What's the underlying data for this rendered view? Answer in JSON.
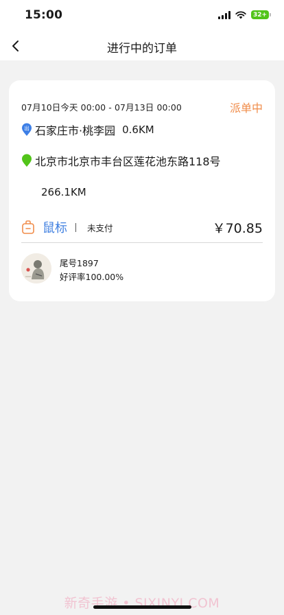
{
  "status_bar": {
    "time": "15:00",
    "battery": "32+",
    "icons": [
      "signal-icon",
      "wifi-icon",
      "battery-icon"
    ]
  },
  "nav": {
    "title": "进行中的订单",
    "back_icon": "chevron-left-icon"
  },
  "order": {
    "time_range": "07月10日今天 00:00 - 07月13日 00:00",
    "status": "派单中",
    "pickup": {
      "icon": "pickup-marker-icon",
      "marker_char": "出",
      "address": "石家庄市·桃李园",
      "distance": "0.6KM"
    },
    "destination": {
      "icon": "location-pin-icon",
      "address": "北京市北京市丰台区莲花池东路118号"
    },
    "total_distance": "266.1KM",
    "goods": {
      "icon": "bag-icon",
      "name": "鼠标",
      "payment_status": "未支付"
    },
    "price": "￥70.85",
    "driver": {
      "plate_tail": "尾号1897",
      "rating": "好评率100.00%"
    }
  },
  "watermark": "新奇手游 • SIXINYI.COM",
  "colors": {
    "accent_orange": "#f08c4a",
    "link_blue": "#3f7fe0",
    "pickup_blue": "#3d7fe6",
    "pin_green": "#52c41a",
    "background": "#f2f2f2"
  }
}
